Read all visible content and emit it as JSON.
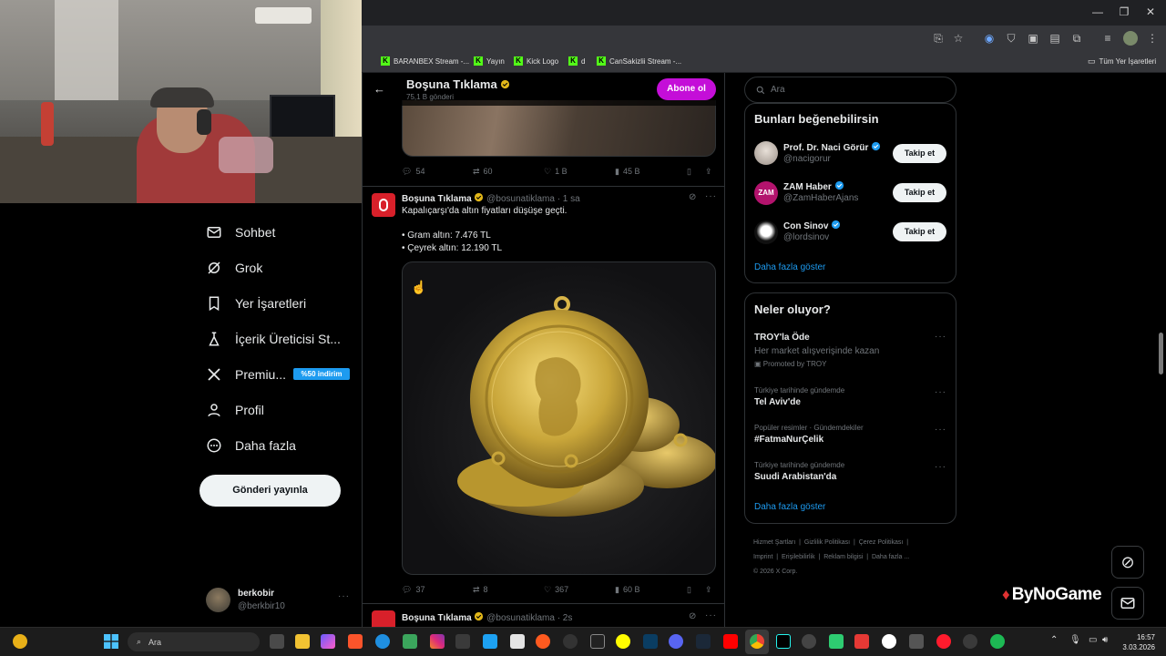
{
  "browser": {
    "bookmarks": [
      "BARANBEX Stream -...",
      "Yayın",
      "Kick Logo",
      "d",
      "CanSakizlii Stream -..."
    ],
    "all_bookmarks": "Tüm Yer İşaretleri"
  },
  "sidebar": {
    "items": [
      {
        "label": "Sohbet",
        "icon": "mail-icon"
      },
      {
        "label": "Grok",
        "icon": "grok-icon"
      },
      {
        "label": "Yer İşaretleri",
        "icon": "bookmark-icon"
      },
      {
        "label": "İçerik Üreticisi St...",
        "icon": "creator-icon"
      },
      {
        "label": "Premiu...",
        "icon": "x-logo-icon"
      },
      {
        "label": "Profil",
        "icon": "person-icon"
      },
      {
        "label": "Daha fazla",
        "icon": "more-circle-icon"
      }
    ],
    "premium_badge": "%50 indirim",
    "post_button": "Gönderi yayınla",
    "user": {
      "name": "berkobir",
      "handle": "@berkbir10"
    }
  },
  "profile_header": {
    "name": "Boşuna Tıklama",
    "subtitle": "75,1 B gönderi",
    "subscribe": "Abone ol"
  },
  "tweets": [
    {
      "replies": "54",
      "retweets": "60",
      "likes": "1 B",
      "views": "45 B"
    },
    {
      "name": "Boşuna Tıklama",
      "handle": "@bosunatiklama",
      "time": "· 1 sa",
      "lines": [
        "Kapalıçarşı'da altın fiyatları düşüşe geçti.",
        "",
        "• Gram altın: 7.476 TL",
        "• Çeyrek altın: 12.190 TL"
      ],
      "replies": "37",
      "retweets": "8",
      "likes": "367",
      "views": "60 B"
    },
    {
      "name": "Boşuna Tıklama",
      "handle": "@bosunatiklama",
      "time": "· 2s"
    }
  ],
  "search": {
    "placeholder": "Ara"
  },
  "suggestions": {
    "title": "Bunları beğenebilirsin",
    "users": [
      {
        "name": "Prof. Dr. Naci Görür",
        "handle": "@nacigorur",
        "button": "Takip et"
      },
      {
        "name": "ZAM Haber",
        "handle": "@ZamHaberAjans",
        "button": "Takip et"
      },
      {
        "name": "Con Sinov",
        "handle": "@lordsinov",
        "button": "Takip et"
      }
    ],
    "show_more": "Daha fazla göster"
  },
  "trends": {
    "title": "Neler oluyor?",
    "items": [
      {
        "name": "TROY'la Öde",
        "desc": "Her market alışverişinde kazan",
        "promo": "Promoted by TROY"
      },
      {
        "context": "Türkiye tarihinde gündemde",
        "name": "Tel Aviv'de"
      },
      {
        "context": "Popüler resimler · Gündemdekiler",
        "name": "#FatmaNurÇelik"
      },
      {
        "context": "Türkiye tarihinde gündemde",
        "name": "Suudi Arabistan'da"
      }
    ],
    "show_more": "Daha fazla göster"
  },
  "footer": {
    "links": [
      "Hizmet Şartları",
      "Gizlilik Politikası",
      "Çerez Politikası",
      "Imprint",
      "Erişilebilirlik",
      "Reklam bilgisi",
      "Daha fazla ..."
    ],
    "copyright": "© 2026 X Corp."
  },
  "overlay": {
    "watermark": "ByNoGame"
  },
  "taskbar": {
    "search": "Ara",
    "time": "16:57",
    "date": "3.03.2026"
  },
  "colors": {
    "accent": "#1d9bf0",
    "subscribe": "#c40ed8",
    "kick": "#53fc18",
    "gold": "#c9a63a"
  }
}
